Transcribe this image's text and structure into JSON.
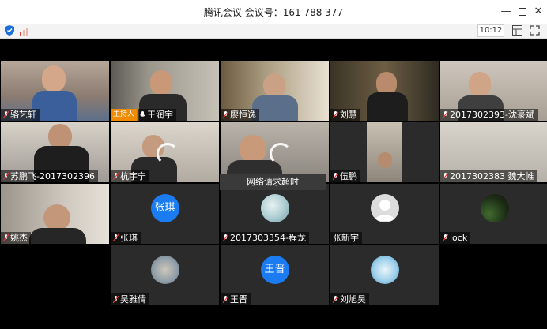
{
  "window": {
    "title": "腾讯会议 会议号：161 788 377",
    "controls": [
      "minimize",
      "maximize",
      "close"
    ]
  },
  "toolbar": {
    "time": "10:12",
    "icons": [
      "shield-icon",
      "signal-icon",
      "layout-icon",
      "fullscreen-icon"
    ]
  },
  "host_badge": "主持人",
  "toast": "网络请求超时",
  "participants": [
    {
      "name": "骆艺轩"
    },
    {
      "name": "王润宇"
    },
    {
      "name": "廖恒逸"
    },
    {
      "name": "刘慧"
    },
    {
      "name": "2017302393-沈豪斌"
    },
    {
      "name": "苏鹏飞-2017302396"
    },
    {
      "name": "杭宇宁"
    },
    {
      "name": ""
    },
    {
      "name": "伍鹏"
    },
    {
      "name": "2017302383 魏大帷"
    },
    {
      "name": "姚杰"
    },
    {
      "name": "张琪",
      "avatar_text": "张琪"
    },
    {
      "name": "2017303354-程龙"
    },
    {
      "name": "张新宇"
    },
    {
      "name": "lock"
    },
    {
      "name": "吴雅倩"
    },
    {
      "name": "王晋",
      "avatar_text": "王晋"
    },
    {
      "name": "刘旭昊"
    }
  ],
  "colors": {
    "host_badge": "#f08a00",
    "avatar_blue": "#1a7cf0",
    "stage_background": "#000000"
  }
}
